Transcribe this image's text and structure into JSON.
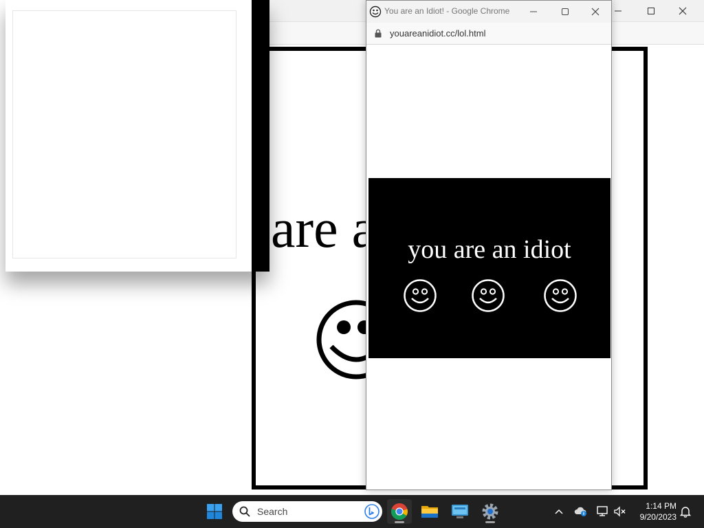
{
  "popup": {
    "title": "You are an Idiot! - Google Chrome",
    "url": "youareanidiot.cc/lol.html",
    "message": "you are an idiot"
  },
  "background_window": {
    "big_text": "are a"
  },
  "taskbar": {
    "search_placeholder": "Search",
    "clock_time": "1:14 PM",
    "clock_date": "9/20/2023",
    "apps": [
      "chrome-icon",
      "file-explorer-icon",
      "remote-desktop-icon",
      "settings-icon"
    ]
  },
  "colors": {
    "taskbar_bg": "#202020",
    "panel_bg": "#000000",
    "panel_text": "#ffffff",
    "windows_blue": "#0078d4"
  }
}
